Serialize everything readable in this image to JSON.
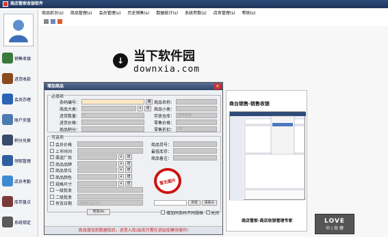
{
  "app": {
    "title": "商店管家收银软件"
  },
  "menu": [
    "商品前台(s)",
    "商品管理(s)",
    "会员管理(s)",
    "历史销售(s)",
    "数据统计(s)",
    "系统参数(s)",
    "店务管理(s)",
    "帮助(s)"
  ],
  "toolbar_colors": [
    "#888888",
    "#6c88c4",
    "#e05a2a"
  ],
  "sidebar": [
    {
      "label": "销售收银",
      "icon": "cash-register-icon",
      "color": "#3a7a3a"
    },
    {
      "label": "进货收款",
      "icon": "briefcase-icon",
      "color": "#8b4a1f"
    },
    {
      "label": "会员办理",
      "icon": "member-icon",
      "color": "#2a62b4"
    },
    {
      "label": "账户充值",
      "icon": "recharge-icon",
      "color": "#4b7ab0"
    },
    {
      "label": "积分兑换",
      "icon": "points-icon",
      "color": "#3a4a6a"
    },
    {
      "label": "领取管理",
      "icon": "shield-icon",
      "color": "#2f5f9f"
    },
    {
      "label": "店员考勤",
      "icon": "staff-icon",
      "color": "#3e8ad0"
    },
    {
      "label": "库存盘点",
      "icon": "inventory-icon",
      "color": "#7a3a3a"
    },
    {
      "label": "系统锁定",
      "icon": "lock-icon",
      "color": "#5a5a5a"
    }
  ],
  "watermark": {
    "cn": "当下软件园",
    "en": "downxia.com",
    "glyph": "↓"
  },
  "promo": {
    "title": "商台销售-销售收银",
    "footer": "商店管家-商店收银管理专家"
  },
  "logo": {
    "top": "LOVE",
    "bottom": "中 | 尚 键"
  },
  "dialog": {
    "title": "增加商品",
    "required_label": "必填项",
    "optional_label": "可选项",
    "left_required": [
      "条码编号：",
      "商品大类：",
      "进货数量：",
      "进货价格：",
      "商品积分："
    ],
    "right_required": [
      "商品名称：",
      "商品小类：",
      "存放仓库：",
      "零售价格：",
      "零售折扣："
    ],
    "barcode_btn": "编",
    "qty_value": "1",
    "warehouse_value": "店内仓库",
    "discount_value": "10",
    "optional_left": [
      {
        "label": "会员价格",
        "checked": false
      },
      {
        "label": "上市时间",
        "checked": false
      },
      {
        "label": "渠道厂商",
        "checked": true
      },
      {
        "label": "商品品牌",
        "checked": true
      },
      {
        "label": "商品单位",
        "checked": true
      },
      {
        "label": "商品颜色",
        "checked": true
      },
      {
        "label": "规格尺寸",
        "checked": true
      },
      {
        "label": "一级批发",
        "checked": false
      },
      {
        "label": "二级批发",
        "checked": false
      },
      {
        "label": "有效日期",
        "checked": false
      }
    ],
    "add_btn": "增",
    "date_value": "2013-12-13",
    "optional_right": [
      "商品货号：",
      "最低库存：",
      "商品备注："
    ],
    "nopic_text": "暂无图片",
    "browse_btn": "浏览",
    "clear_btn": "清除头",
    "add_button": "增加(A)",
    "rename_check": "增加同条码不同规格",
    "close_check": "关闭",
    "status": "商品增加到数据库后，进货入库/出库只需在进出库模块操作!"
  }
}
